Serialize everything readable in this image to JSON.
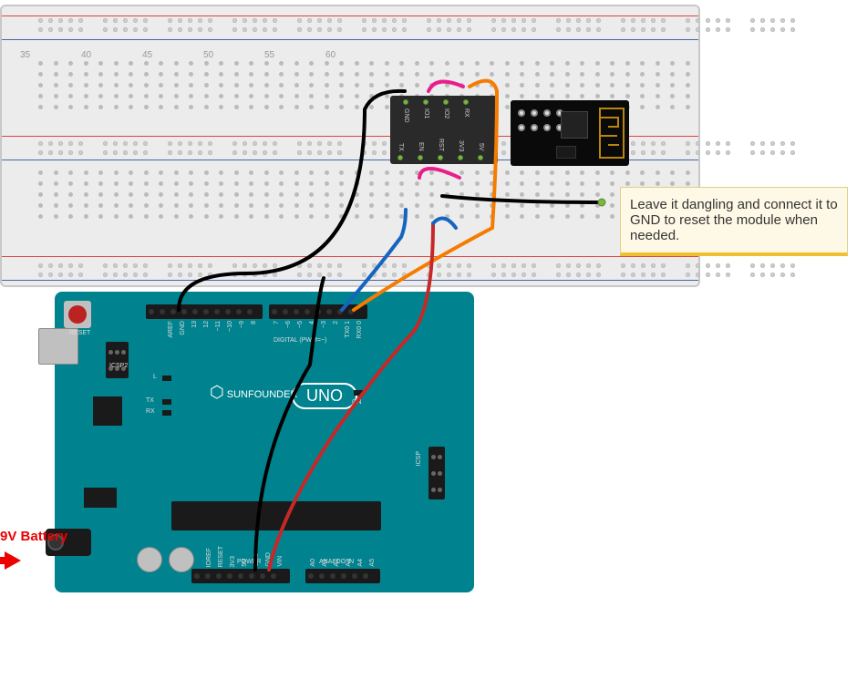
{
  "annotation": {
    "text": "Leave it dangling and connect it to GND to reset the module when needed."
  },
  "battery": {
    "label": "9V Battery"
  },
  "arduino": {
    "board_name": "UNO",
    "brand": "SUNFOUNDER",
    "reset_label": "RESET",
    "icsp2_label": "ICSP2",
    "icsp_label": "ICSP",
    "digital_header_label": "DIGITAL (PWM=~)",
    "power_label": "POWER",
    "analog_label": "ANALOG IN",
    "on_label": "ON",
    "leds": {
      "l": "L",
      "tx": "TX",
      "rx": "RX"
    },
    "top_pins_left": [
      "AREF",
      "GND",
      "13",
      "12",
      "~11",
      "~10",
      "~9",
      "8"
    ],
    "top_pins_right": [
      "7",
      "~6",
      "~5",
      "4",
      "~3",
      "2",
      "TX0 1",
      "RX0 0"
    ],
    "power_pins": [
      "IOREF",
      "RESET",
      "3V3",
      "5V",
      "GND",
      "GND",
      "VIN"
    ],
    "analog_pins": [
      "A0",
      "A1",
      "A2",
      "A3",
      "A4",
      "A5"
    ]
  },
  "esp_adapter": {
    "pins_top": [
      "GND",
      "IO1",
      "IO2",
      "RX"
    ],
    "pins_bot": [
      "TX",
      "EN",
      "RST",
      "3V3",
      "5V"
    ]
  },
  "breadboard": {
    "col_labels": [
      "35",
      "40",
      "45",
      "50",
      "55",
      "60"
    ]
  },
  "wires": [
    {
      "name": "gnd-arduino-to-gnd-module",
      "color": "black"
    },
    {
      "name": "vin-5v-to-module",
      "color": "black"
    },
    {
      "name": "3v3-jumper",
      "color": "magenta"
    },
    {
      "name": "en-jumper",
      "color": "magenta"
    },
    {
      "name": "tx-arduino-to-rx-module",
      "color": "orange"
    },
    {
      "name": "rx-arduino-to-tx-module",
      "color": "blue"
    },
    {
      "name": "5v-to-module",
      "color": "red"
    },
    {
      "name": "rst-dangling",
      "color": "black"
    }
  ]
}
